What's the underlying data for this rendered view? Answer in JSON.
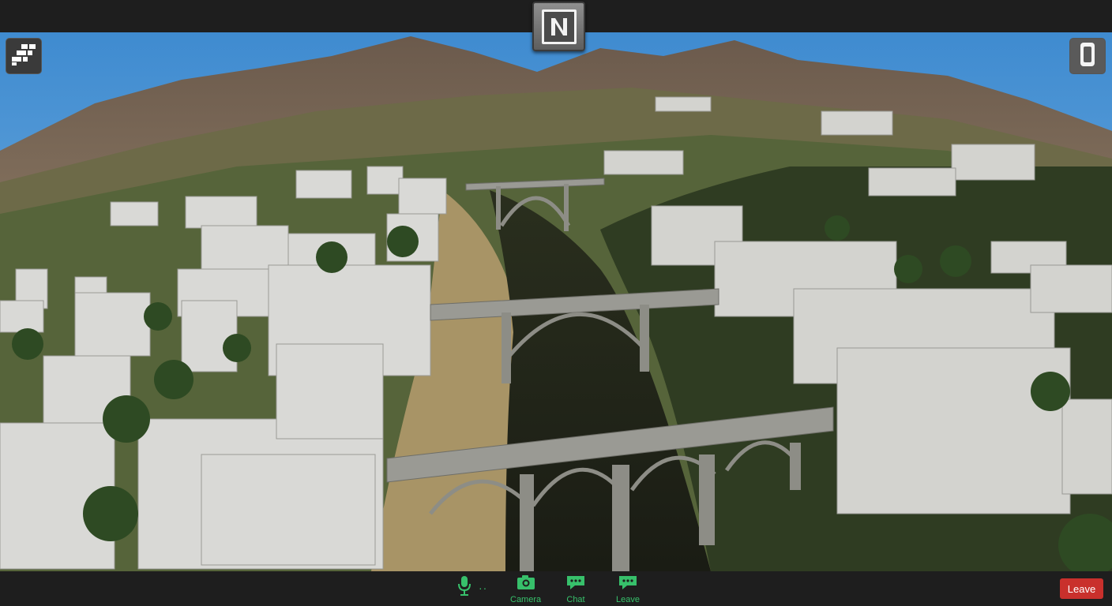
{
  "meeting": {
    "host_badge_icon": "host-n-icon",
    "feed_description_icon": "aerial-video-feed"
  },
  "top_left_button": {
    "icon": "apps-grid-icon"
  },
  "top_right_button": {
    "icon": "phone-icon"
  },
  "controls": {
    "mic_icon": "microphone-icon",
    "camera_label": "Camera",
    "chat_label": "Chat",
    "leave_label_secondary": "Leave",
    "leave_button": "Leave"
  },
  "colors": {
    "accent_green": "#37c06b",
    "leave_red": "#c9302c",
    "bar_background": "#1e1e1e"
  }
}
